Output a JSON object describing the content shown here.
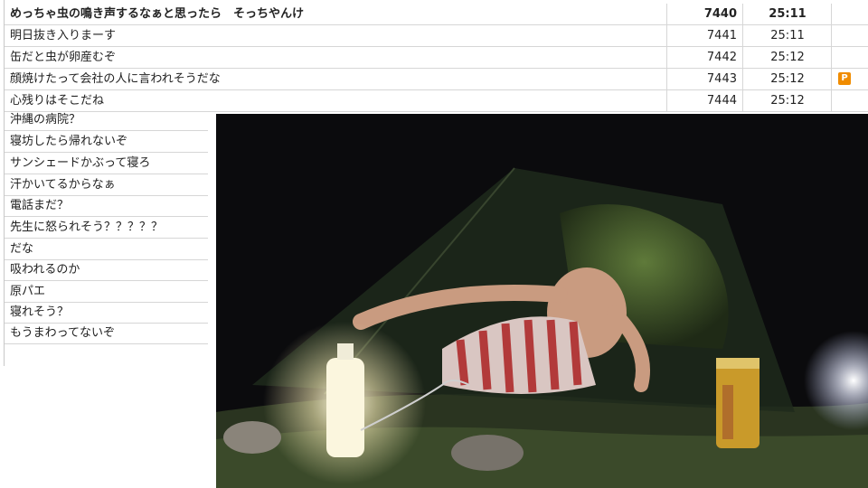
{
  "comments": [
    {
      "text": "めっちゃ虫の鳴き声するなぁと思ったら　そっちやんけ",
      "no": "7440",
      "time": "25:11",
      "premium": false,
      "bold": true
    },
    {
      "text": "明日抜き入りまーす",
      "no": "7441",
      "time": "25:11",
      "premium": false,
      "bold": false
    },
    {
      "text": "缶だと虫が卵産むぞ",
      "no": "7442",
      "time": "25:12",
      "premium": false,
      "bold": false
    },
    {
      "text": "顔焼けたって会社の人に言われそうだな",
      "no": "7443",
      "time": "25:12",
      "premium": true,
      "bold": false
    },
    {
      "text": "心残りはそこだね",
      "no": "7444",
      "time": "25:12",
      "premium": false,
      "bold": false
    }
  ],
  "overlay_comments": [
    "沖縄の病院？",
    "寝坊したら帰れないぞ",
    "サンシェードかぶって寝ろ",
    "汗かいてるからなぁ",
    "電話まだ？",
    "先生に怒られそう？？？？？",
    "だな",
    "吸われるのか",
    "原パエ",
    "寝れそう？",
    "もうまわってないぞ"
  ],
  "premium_badge": "P",
  "colors": {
    "premium_badge": "#f08c00",
    "grid_line": "#d6d6d6"
  }
}
